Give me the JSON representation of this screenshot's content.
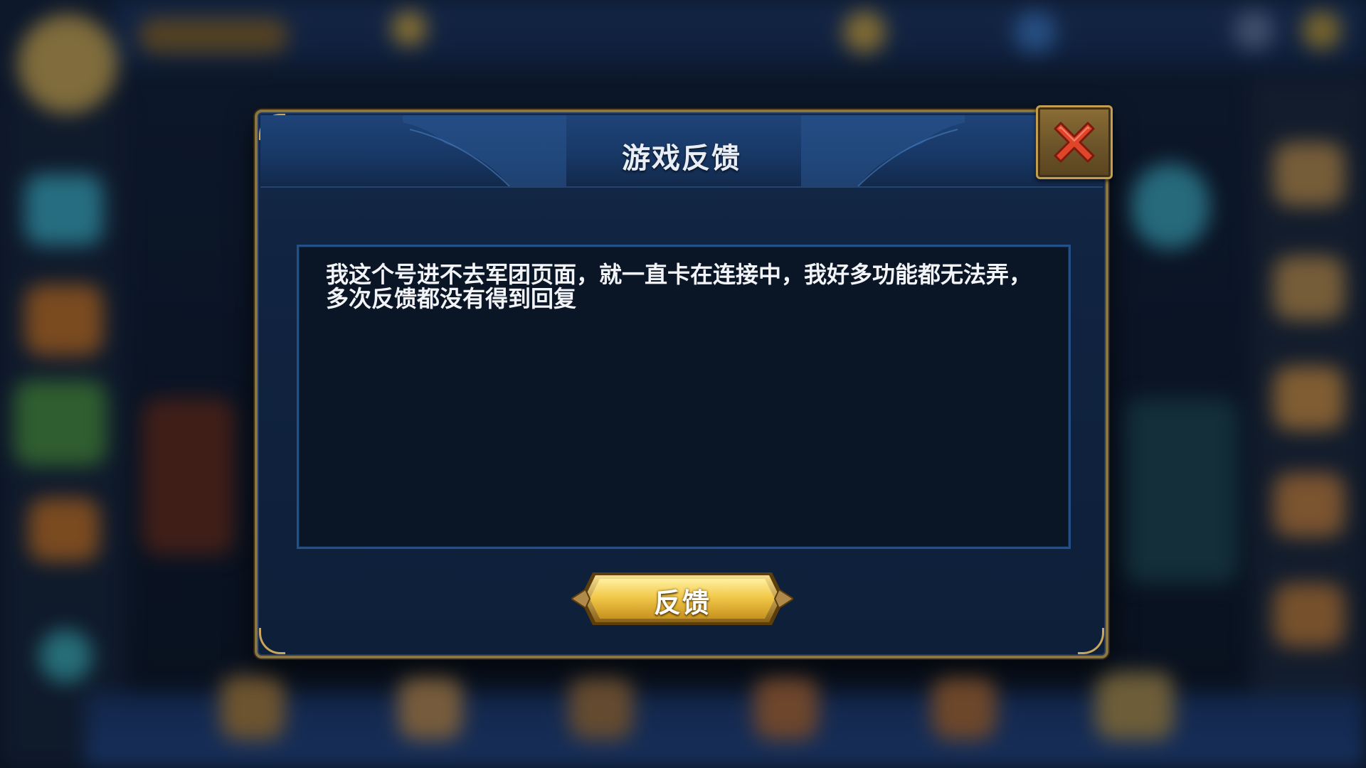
{
  "dialog": {
    "title": "游戏反馈",
    "close_icon": "close-x-icon",
    "feedback_text": "我这个号进不去军团页面，就一直卡在连接中，我好多功能都无法弄，多次反馈都没有得到回复",
    "submit_label": "反馈"
  },
  "colors": {
    "frame_gold": "#c9a65a",
    "panel_blue": "#102340",
    "textarea_bg": "#0a1626",
    "close_red": "#e0452a",
    "button_gold": "#f2c94a"
  }
}
